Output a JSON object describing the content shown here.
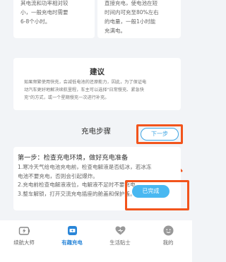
{
  "top_cards": {
    "left_text": "其电流和功率相对较\n小，一般充电时需要\n6-8个小时。",
    "right_text": "直接充电，使电池在短\n时间内可充至80%左右\n的电量，一般1小时能\n充满电。"
  },
  "advice": {
    "title": "建议",
    "body": "如果频繁使用快充，会减低电池的还原能力，因此，为了保证电\n动汽车更好地解决续航里程，车主可以选择\"日常慢充、紧急快\n充\"的方式，或一个星期慢充一次进行补充。"
  },
  "steps": {
    "title": "充电步骤",
    "next_label": "下一步",
    "heading": "第一步：检查充电环境，做好充电准备",
    "body": "1.寒冷天气给电池充电前，检查电解液是否结冰，若冰冻\n电池不要充电，否则会引起爆炸。\n2.充电前检查电解液液位，电解液不足时不要充电。\n3.整车解锁，打开交流充电插座的舱盖和保护盖。",
    "done_label": "已完成"
  },
  "colors": {
    "accent": "#2a86d8",
    "button_blue": "#49b8f1",
    "highlight_orange": "#f2541c"
  },
  "tabs": [
    {
      "label": "续航大师",
      "icon": "battery-icon",
      "active": false
    },
    {
      "label": "有趣充电",
      "icon": "charging-icon",
      "active": true
    },
    {
      "label": "生活贴士",
      "icon": "heart-icon",
      "active": false
    },
    {
      "label": "我的",
      "icon": "profile-icon",
      "active": false
    }
  ]
}
